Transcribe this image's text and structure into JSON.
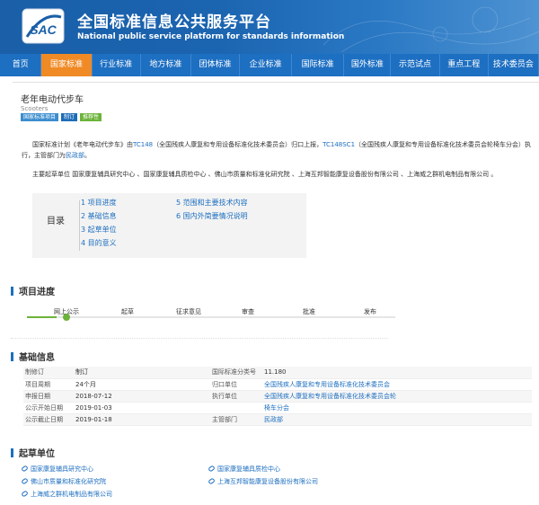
{
  "header": {
    "logo_text": "SAC",
    "title_cn": "全国标准信息公共服务平台",
    "title_en": "National public service platform  for standards information"
  },
  "nav": [
    "首页",
    "国家标准",
    "行业标准",
    "地方标准",
    "团体标准",
    "企业标准",
    "国际标准",
    "国外标准",
    "示范试点",
    "重点工程",
    "技术委员会"
  ],
  "nav_active": 1,
  "standard": {
    "title": "老年电动代步车",
    "title_en": "Scooters",
    "tags": [
      "国家标准项目",
      "制订",
      "推荐性"
    ],
    "intro_1": "国家标准计划《老年电动代步车》由",
    "tc1": "TC148",
    "intro_2": "（全国残疾人康复和专用设备标准化技术委员会）归口上报，",
    "tc2": "TC148SC1",
    "intro_3": "（全国残疾人康复和专用设备标准化技术委员会轮椅车分会）执行，主管部门为",
    "dept": "民政部",
    "intro_end": "。",
    "drafters": "主要起草单位 国家康复辅具研究中心 、国家康复辅具质检中心 、佛山市质量和标准化研究院 、上海互邦智能康复设备股份有限公司 、上海威之群机电制品有限公司 。"
  },
  "toc": {
    "label": "目录",
    "items": [
      "1  项目进度",
      "2  基础信息",
      "3  起草单位",
      "4  目的意义",
      "5  范围和主要技术内容",
      "6  国内外简要情况说明"
    ]
  },
  "sections": {
    "progress": "项目进度",
    "basic": "基础信息",
    "drafters": "起草单位"
  },
  "progress": {
    "steps": [
      "网上公示",
      "起草",
      "征求意见",
      "审查",
      "批准",
      "发布"
    ],
    "current": 0,
    "fill_fraction": 0.08
  },
  "basic_info": [
    {
      "k1": "制修订",
      "v1": "制订",
      "k2": "国际标准分类号",
      "v2": "11.180",
      "link2": false
    },
    {
      "k1": "项目周期",
      "v1": "24个月",
      "k2": "归口单位",
      "v2": "全国残疾人康复和专用设备标准化技术委员会",
      "link2": true
    },
    {
      "k1": "申报日期",
      "v1": "2018-07-12",
      "k2": "执行单位",
      "v2": "全国残疾人康复和专用设备标准化技术委员会轮",
      "link2": true
    },
    {
      "k1": "公示开始日期",
      "v1": "2019-01-03",
      "k2": "",
      "v2": "椅车分会",
      "link2": true
    },
    {
      "k1": "公示截止日期",
      "v1": "2019-01-18",
      "k2": "主管部门",
      "v2": "民政部",
      "link2": true
    }
  ],
  "orgs": [
    "国家康复辅具研究中心",
    "国家康复辅具质检中心",
    "佛山市质量和标准化研究院",
    "上海互邦智能康复设备股份有限公司",
    "上海威之群机电制品有限公司"
  ]
}
